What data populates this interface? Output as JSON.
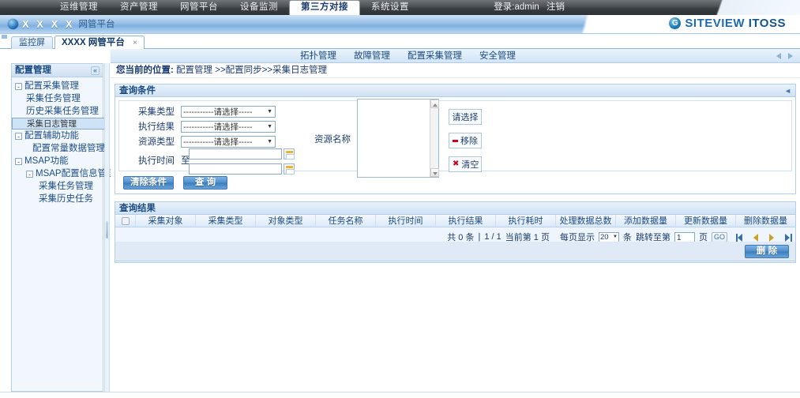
{
  "topnav": {
    "items": [
      {
        "label": "运维管理",
        "active": false
      },
      {
        "label": "资产管理",
        "active": false
      },
      {
        "label": "网管平台",
        "active": false
      },
      {
        "label": "设备监测",
        "active": false
      },
      {
        "label": "第三方对接",
        "active": true
      },
      {
        "label": "系统设置",
        "active": false
      }
    ],
    "login_text": "登录:admin",
    "logout_label": "注销"
  },
  "brand": {
    "x_text": "X X X X",
    "sub_text": "网管平台",
    "logo_mark": "G",
    "logo_word1": "SITEVIEW",
    "logo_word2": "ITOSS"
  },
  "tabs": [
    {
      "label": "监控屏",
      "active": false,
      "closable": false
    },
    {
      "label": "XXXX 网管平台",
      "active": true,
      "closable": true,
      "close_glyph": "×"
    }
  ],
  "sidebar": {
    "title": "配置管理",
    "collapse_glyph": "«",
    "items": [
      {
        "label": "配置采集管理",
        "level": 1,
        "expander": "-",
        "selected": false
      },
      {
        "label": "采集任务管理",
        "level": 2,
        "expander": "",
        "selected": false
      },
      {
        "label": "历史采集任务管理",
        "level": 2,
        "expander": "",
        "selected": false
      },
      {
        "label": "采集日志管理",
        "level": 2,
        "expander": "",
        "selected": true
      },
      {
        "label": "配置辅助功能",
        "level": 1,
        "expander": "-",
        "selected": false
      },
      {
        "label": "配置常量数据管理",
        "level": 2,
        "expander": "",
        "selected": false
      },
      {
        "label": "MSAP功能",
        "level": 1,
        "expander": "-",
        "selected": false
      },
      {
        "label": "MSAP配置信息管理",
        "level": 2,
        "expander": "-",
        "selected": false
      },
      {
        "label": "采集任务管理",
        "level": 3,
        "expander": "",
        "selected": false
      },
      {
        "label": "采集历史任务",
        "level": 3,
        "expander": "",
        "selected": false
      }
    ]
  },
  "subnav": {
    "items": [
      "拓扑管理",
      "故障管理",
      "配置采集管理",
      "安全管理"
    ]
  },
  "breadcrumb": {
    "prefix": "您当前的位置:",
    "path": "配置管理 >>配置同步>>采集日志管理"
  },
  "query_panel": {
    "title": "查询条件",
    "collapse_glyph": "◄",
    "placeholder_select": "-----------请选择-----",
    "fields": {
      "collect_type_label": "采集类型",
      "collect_type_value": "-----------请选择-----",
      "exec_result_label": "执行结果",
      "exec_result_value": "-----------请选择-----",
      "resource_type_label": "资源类型",
      "resource_type_value": "-----------请选择-----",
      "exec_time_label": "执行时间",
      "exec_time_to": "至",
      "exec_time_from_value": "",
      "exec_time_until_value": "",
      "resource_name_label": "资源名称"
    },
    "side_buttons": [
      {
        "label": "请选择",
        "icon": "none"
      },
      {
        "label": "移除",
        "icon": "minus-icon"
      },
      {
        "label": "清空",
        "icon": "x-icon"
      }
    ],
    "buttons": {
      "clear_label": "清除条件",
      "query_label": "查 询"
    },
    "caret_glyph": "▼"
  },
  "result_panel": {
    "title": "查询结果",
    "columns": [
      "采集对象",
      "采集类型",
      "对象类型",
      "任务名称",
      "执行时间",
      "执行结果",
      "执行耗时",
      "处理数据总数",
      "添加数据量",
      "更新数据量",
      "删除数据量"
    ],
    "rows": [],
    "pager": {
      "total_text": "共 0 条",
      "separator": "|",
      "page_of": "1 / 1",
      "current_text": "当前第 1 页",
      "per_page_label": "每页显示",
      "per_page_value": "20",
      "per_page_unit": "条",
      "jump_label": "跳转至第",
      "jump_value": "1",
      "jump_unit": "页",
      "go_label": "GO",
      "caret_glyph": "▼"
    },
    "delete_label": "删 除"
  },
  "colors": {
    "accent": "#3a7cbc",
    "panel_border": "#b4cee7",
    "selection": "#cfe3f7",
    "danger": "#d0021b",
    "logo_blue": "#1f6bb0"
  }
}
